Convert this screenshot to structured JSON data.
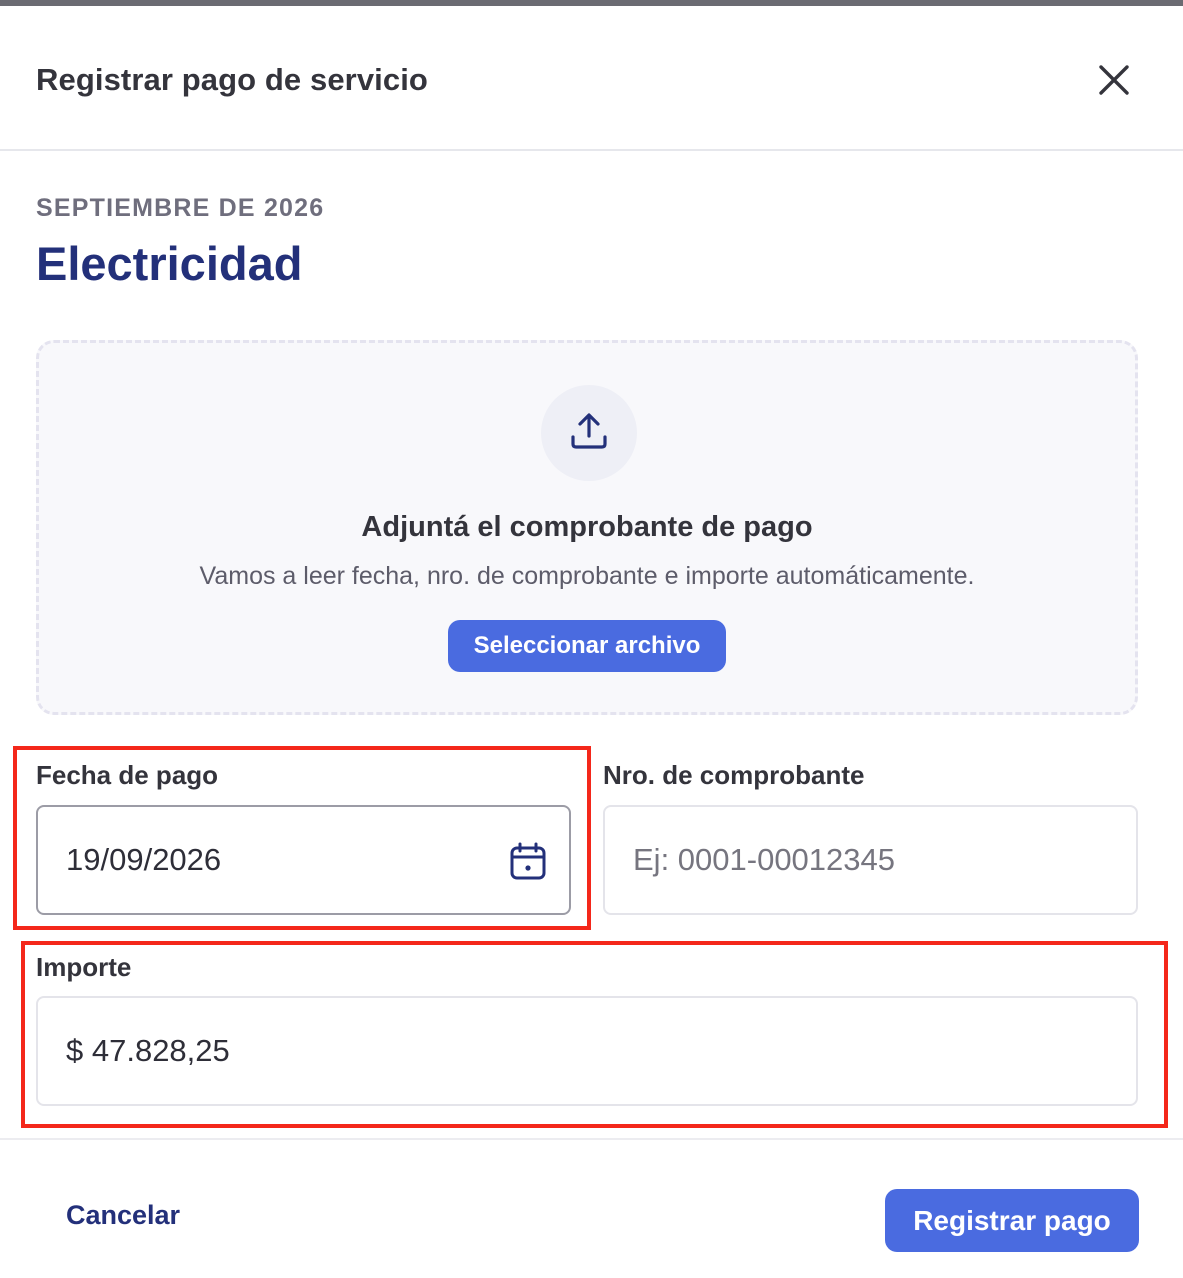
{
  "modal": {
    "title": "Registrar pago de servicio",
    "close_icon": "close-icon"
  },
  "service": {
    "period": "SEPTIEMBRE DE 2026",
    "name": "Electricidad"
  },
  "upload": {
    "icon": "upload-icon",
    "title": "Adjuntá el comprobante de pago",
    "subtitle": "Vamos a leer fecha, nro. de comprobante e importe automáticamente.",
    "button_label": "Seleccionar archivo"
  },
  "form": {
    "payment_date": {
      "label": "Fecha de pago",
      "value": "19/09/2026",
      "icon": "calendar-icon"
    },
    "receipt_number": {
      "label": "Nro. de comprobante",
      "value": "",
      "placeholder": "Ej: 0001-00012345"
    },
    "amount": {
      "label": "Importe",
      "value": "$ 47.828,25"
    }
  },
  "footer": {
    "cancel_label": "Cancelar",
    "submit_label": "Registrar pago"
  },
  "colors": {
    "accent": "#4a6be0",
    "heading": "#23307a",
    "highlight": "#f4271a"
  }
}
